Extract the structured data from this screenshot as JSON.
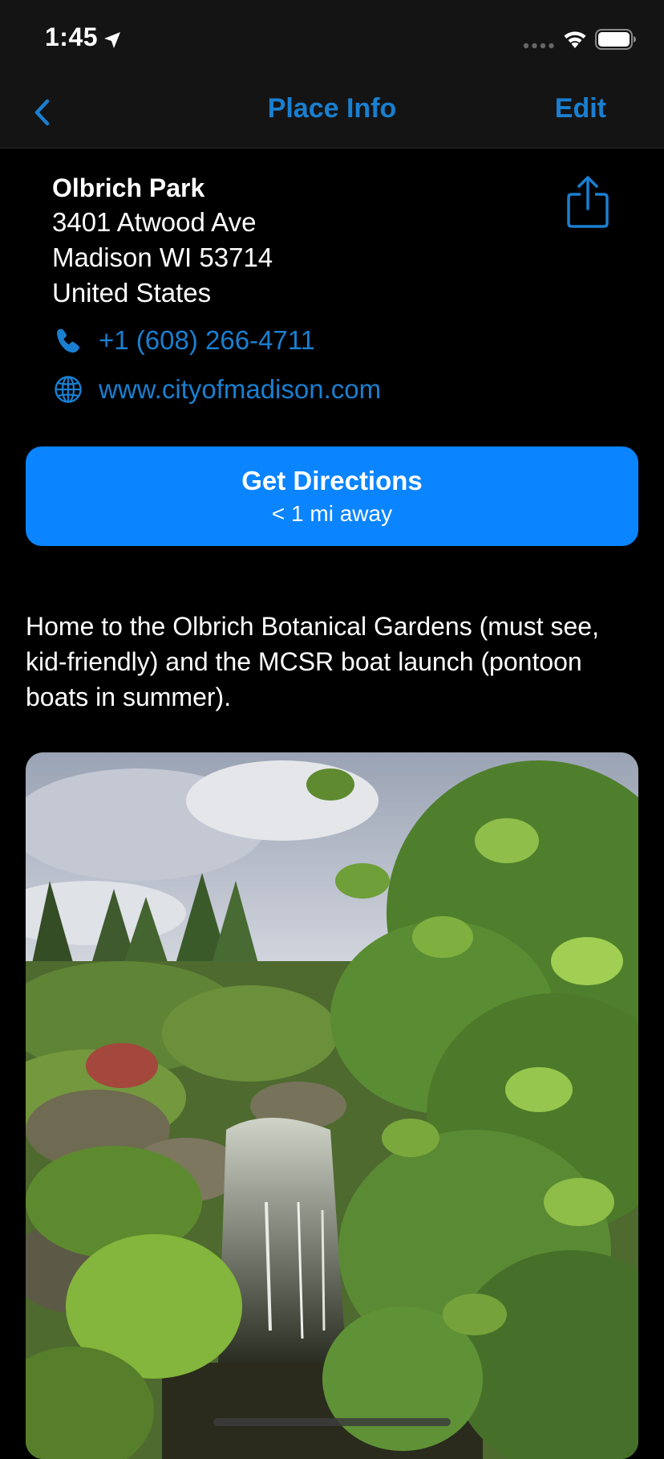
{
  "status_bar": {
    "time": "1:45"
  },
  "nav": {
    "title": "Place Info",
    "edit_label": "Edit"
  },
  "place": {
    "name": "Olbrich Park",
    "address": [
      "3401 Atwood Ave",
      "Madison WI 53714",
      "United States"
    ],
    "phone": "+1 (608) 266-4711",
    "website": "www.cityofmadison.com"
  },
  "directions": {
    "label": "Get Directions",
    "distance": "< 1 mi away"
  },
  "description": "Home to the Olbrich Botanical Gardens (must see, kid-friendly) and the MCSR boat launch (pontoon boats in summer).",
  "icons": {
    "location": "location-arrow-icon",
    "signal": "cellular-signal-icon",
    "wifi": "wifi-icon",
    "battery": "battery-icon",
    "back": "chevron-left-icon",
    "share": "share-icon",
    "phone": "phone-icon",
    "website": "globe-icon"
  },
  "colors": {
    "accent": "#1a7fd0",
    "button": "#0a84ff",
    "background": "#000000",
    "bar": "#141414"
  }
}
